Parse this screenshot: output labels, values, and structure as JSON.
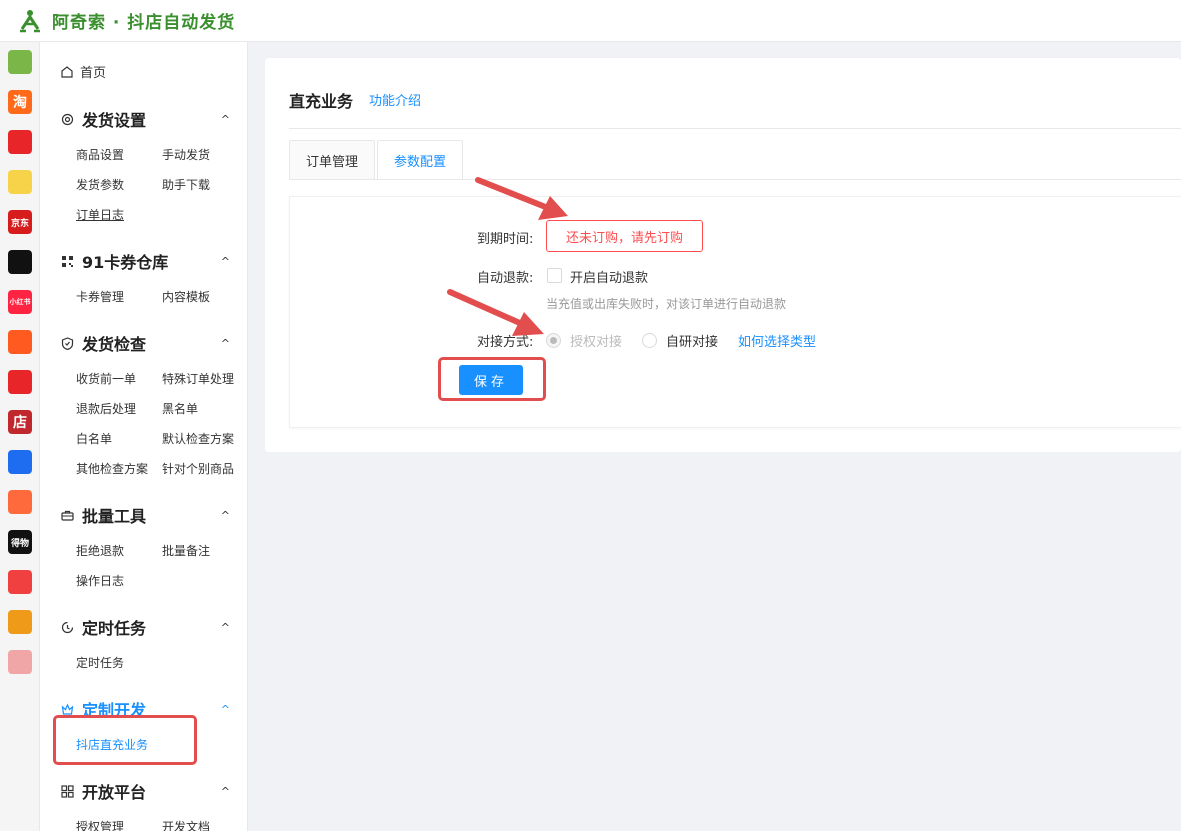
{
  "app": {
    "brand": "阿奇索 · 抖店自动发货",
    "brand_color": "#3a8f2e",
    "accent": "#1890ff",
    "error": "#ff4d4f"
  },
  "rail": {
    "items": [
      {
        "name": "grid-icon",
        "text": "",
        "color": "#7ab648"
      },
      {
        "name": "taobao-icon",
        "text": "淘",
        "color": "#ff6a1a"
      },
      {
        "name": "heart-grid-icon",
        "text": "",
        "color": "#e8262a"
      },
      {
        "name": "yellow-app-icon",
        "text": "",
        "color": "#f7d34a"
      },
      {
        "name": "jd-icon",
        "text": "京东",
        "color": "#d71c1e"
      },
      {
        "name": "tiktok-icon",
        "text": "",
        "color": "#111111"
      },
      {
        "name": "xiaohongshu-icon",
        "text": "小红书",
        "color": "#ff2442"
      },
      {
        "name": "circles-app-icon",
        "text": "",
        "color": "#ff5a1f"
      },
      {
        "name": "thumbs-up-icon",
        "text": "",
        "color": "#e8262a"
      },
      {
        "name": "shop-icon",
        "text": "店",
        "color": "#c0282e"
      },
      {
        "name": "link-app-icon",
        "text": "",
        "color": "#1e6cf0"
      },
      {
        "name": "bag-app-icon",
        "text": "",
        "color": "#ff6a3d"
      },
      {
        "name": "dewu-icon",
        "text": "得物",
        "color": "#111111"
      },
      {
        "name": "red-app-icon",
        "text": "",
        "color": "#f04040"
      },
      {
        "name": "tiger-app-icon",
        "text": "",
        "color": "#f09a1a"
      },
      {
        "name": "pink-bag-icon",
        "text": "",
        "color": "#f0a6a6"
      }
    ]
  },
  "sidebar": {
    "home": "首页",
    "sections": [
      {
        "title": "发货设置",
        "items": [
          "商品设置",
          "手动发货",
          "发货参数",
          "助手下载",
          "订单日志"
        ]
      },
      {
        "title": "91卡券仓库",
        "items": [
          "卡券管理",
          "内容模板"
        ]
      },
      {
        "title": "发货检查",
        "items": [
          "收货前一单",
          "特殊订单处理",
          "退款后处理",
          "黑名单",
          "白名单",
          "默认检查方案",
          "其他检查方案",
          "针对个别商品"
        ]
      },
      {
        "title": "批量工具",
        "items": [
          "拒绝退款",
          "批量备注",
          "操作日志"
        ]
      },
      {
        "title": "定时任务",
        "items": [
          "定时任务"
        ]
      },
      {
        "title": "定制开发",
        "items": [
          "抖店直充业务"
        ]
      },
      {
        "title": "开放平台",
        "items": [
          "授权管理",
          "开发文档"
        ]
      }
    ],
    "caret": "^"
  },
  "main": {
    "title": "直充业务",
    "intro_link": "功能介绍",
    "tabs": [
      "订单管理",
      "参数配置"
    ],
    "active_tab": 1,
    "form": {
      "expire_label": "到期时间:",
      "expire_value": "还未订购，请先订购",
      "auto_refund_label": "自动退款:",
      "auto_refund_option": "开启自动退款",
      "auto_refund_hint": "当充值或出库失败时，对该订单进行自动退款",
      "connect_label": "对接方式:",
      "connect_options": [
        "授权对接",
        "自研对接"
      ],
      "connect_selected": 0,
      "connect_help": "如何选择类型",
      "save": "保存"
    }
  }
}
